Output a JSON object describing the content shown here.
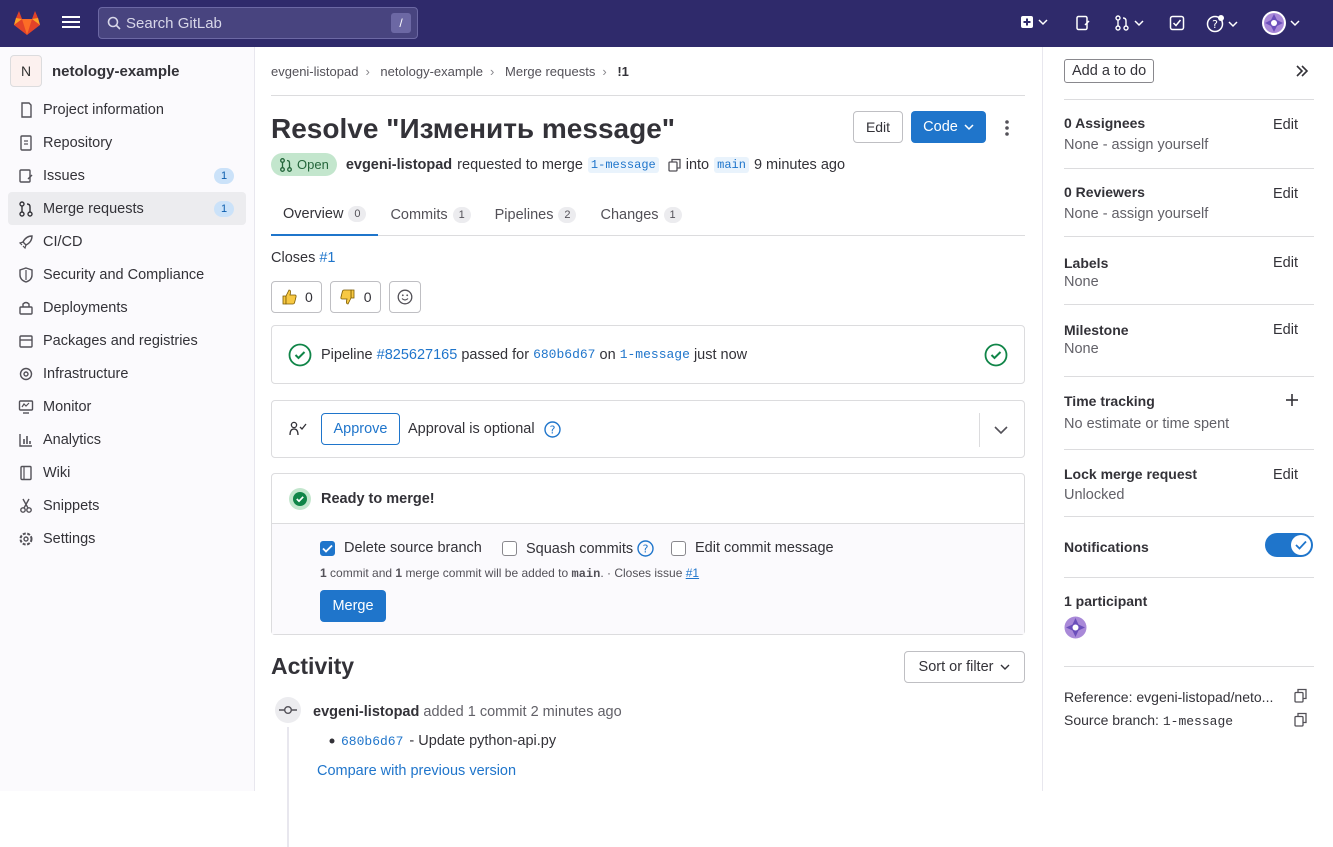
{
  "search": {
    "placeholder": "Search GitLab",
    "shortcut": "/"
  },
  "sidebar": {
    "project_initial": "N",
    "project_name": "netology-example",
    "items": [
      {
        "label": "Project information",
        "icon": "info-icon"
      },
      {
        "label": "Repository",
        "icon": "doc-icon"
      },
      {
        "label": "Issues",
        "icon": "issues-icon",
        "count": "1"
      },
      {
        "label": "Merge requests",
        "icon": "merge-request-icon",
        "count": "1",
        "active": true
      },
      {
        "label": "CI/CD",
        "icon": "rocket-icon"
      },
      {
        "label": "Security and Compliance",
        "icon": "shield-icon"
      },
      {
        "label": "Deployments",
        "icon": "deployments-icon"
      },
      {
        "label": "Packages and registries",
        "icon": "package-icon"
      },
      {
        "label": "Infrastructure",
        "icon": "cloud-gear-icon"
      },
      {
        "label": "Monitor",
        "icon": "monitor-icon"
      },
      {
        "label": "Analytics",
        "icon": "chart-icon"
      },
      {
        "label": "Wiki",
        "icon": "book-icon"
      },
      {
        "label": "Snippets",
        "icon": "snippet-icon"
      },
      {
        "label": "Settings",
        "icon": "gear-icon"
      }
    ]
  },
  "breadcrumb": [
    "evgeni-listopad",
    "netology-example",
    "Merge requests",
    "!1"
  ],
  "mr": {
    "title": "Resolve \"Изменить message\"",
    "edit_label": "Edit",
    "code_label": "Code",
    "status": "Open",
    "author": "evgeni-listopad",
    "requested_text": "requested to merge",
    "source_branch": "1-message",
    "into_text": "into",
    "target_branch": "main",
    "time": "9 minutes ago"
  },
  "tabs": [
    {
      "label": "Overview",
      "count": "0"
    },
    {
      "label": "Commits",
      "count": "1"
    },
    {
      "label": "Pipelines",
      "count": "2"
    },
    {
      "label": "Changes",
      "count": "1"
    }
  ],
  "closes": {
    "text": "Closes",
    "issue": "#1"
  },
  "reactions": {
    "thumbsup": "0",
    "thumbsdown": "0"
  },
  "pipeline": {
    "prefix": "Pipeline",
    "id": "#825627165",
    "status": "passed for",
    "sha": "680b6d67",
    "on": "on",
    "branch": "1-message",
    "time": "just now"
  },
  "approval": {
    "button": "Approve",
    "text": "Approval is optional"
  },
  "merge": {
    "ready": "Ready to merge!",
    "delete_branch": "Delete source branch",
    "squash": "Squash commits",
    "edit_msg": "Edit commit message",
    "note_n1": "1",
    "note_a": "commit and",
    "note_n2": "1",
    "note_b": "merge commit will be added to",
    "note_branch": "main",
    "note_c": ". · Closes issue",
    "note_issue": "#1",
    "button": "Merge"
  },
  "activity": {
    "title": "Activity",
    "sort": "Sort or filter",
    "author": "evgeni-listopad",
    "action": "added 1 commit 2 minutes ago",
    "commit_sha": "680b6d67",
    "commit_msg": "- Update python-api.py",
    "compare": "Compare with previous version"
  },
  "right": {
    "todo": "Add a to do",
    "assignees_h": "0 Assignees",
    "assignees_v": "None - assign yourself",
    "reviewers_h": "0 Reviewers",
    "reviewers_v": "None - assign yourself",
    "labels_h": "Labels",
    "labels_v": "None",
    "milestone_h": "Milestone",
    "milestone_v": "None",
    "time_h": "Time tracking",
    "time_v": "No estimate or time spent",
    "lock_h": "Lock merge request",
    "lock_v": "Unlocked",
    "notif_h": "Notifications",
    "participants_h": "1 participant",
    "edit": "Edit",
    "ref_label": "Reference:",
    "ref_value": "evgeni-listopad/neto...",
    "src_label": "Source branch:",
    "src_value": "1-message"
  },
  "colors": {
    "header": "#2f2a6b",
    "accent": "#1f75cb",
    "success": "#108548"
  }
}
